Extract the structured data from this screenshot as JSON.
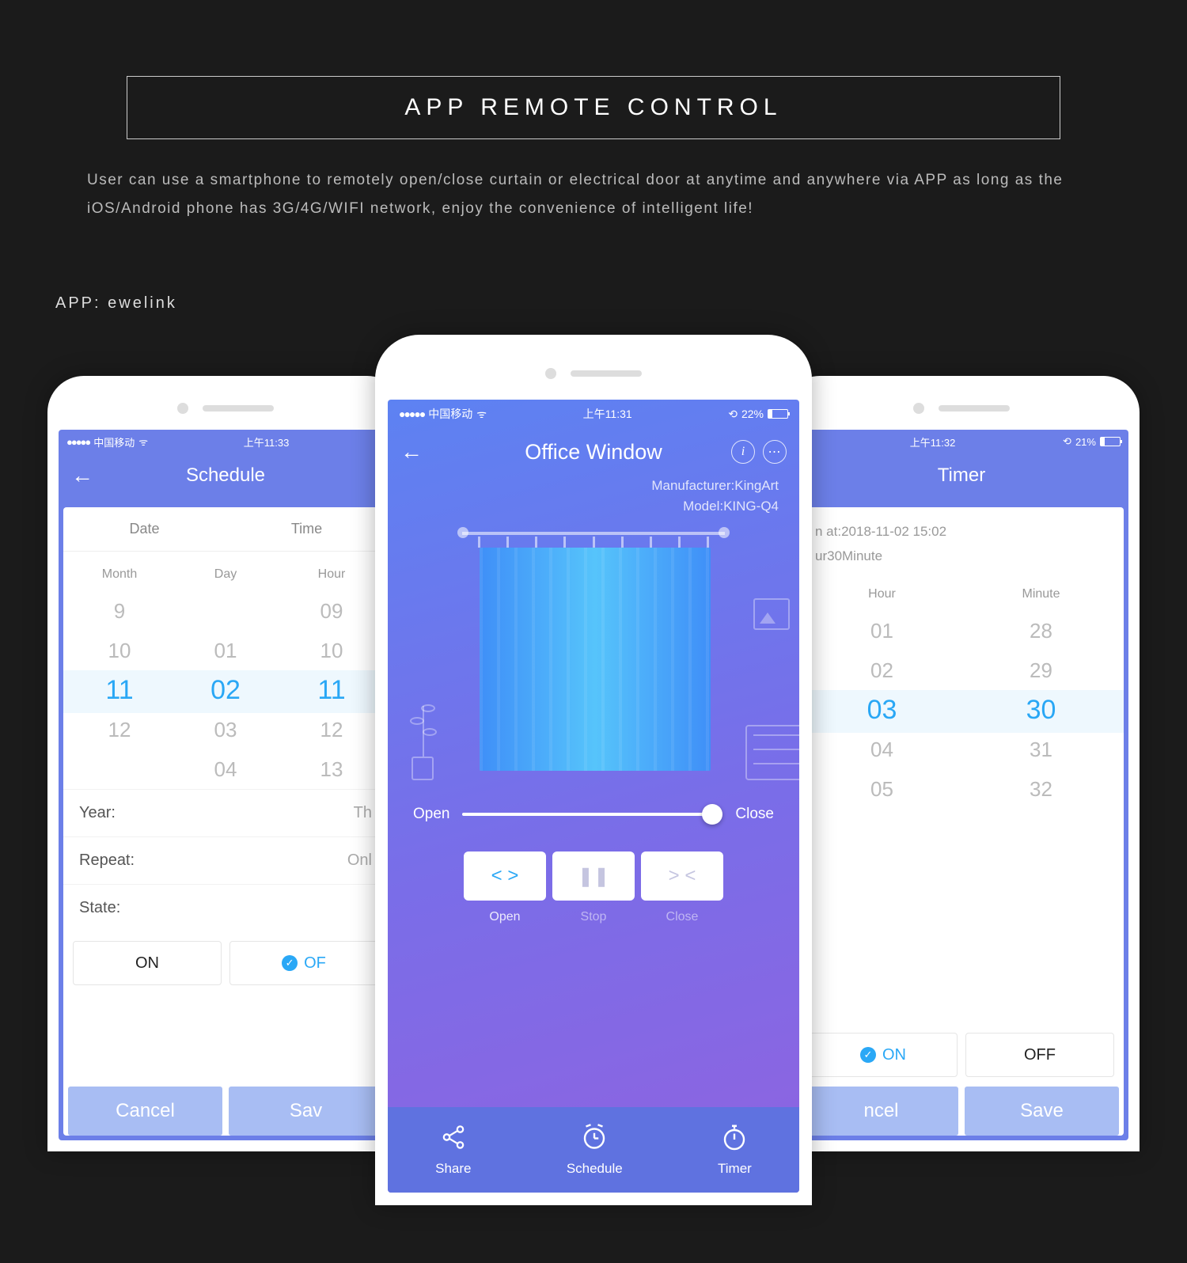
{
  "banner": {
    "title": "APP REMOTE CONTROL",
    "desc": "User can use a smartphone to remotely open/close curtain or electrical door at anytime and anywhere via APP as long as the iOS/Android phone has 3G/4G/WIFI network, enjoy the convenience of intelligent life!"
  },
  "app_label": "APP: ewelink",
  "left": {
    "status": {
      "carrier": "中国移动",
      "time": "上午11:33"
    },
    "title": "Schedule",
    "tabs": [
      "Date",
      "Time"
    ],
    "cols": [
      "Month",
      "Day",
      "Hour"
    ],
    "month": [
      "9",
      "10",
      "11",
      "12",
      ""
    ],
    "day": [
      "",
      "01",
      "02",
      "03",
      "04"
    ],
    "hour": [
      "09",
      "10",
      "11",
      "12",
      "13"
    ],
    "rows": {
      "year": "Year:",
      "year_v": "Th",
      "repeat": "Repeat:",
      "repeat_v": "Onl",
      "state": "State:"
    },
    "on": "ON",
    "off": "OF",
    "cancel": "Cancel",
    "save": "Sav"
  },
  "center": {
    "status": {
      "carrier": "中国移动",
      "time": "上午11:31",
      "batt": "22%"
    },
    "title": "Office Window",
    "manu_l": "Manufacturer:",
    "manu_v": "KingArt",
    "model_l": "Model:",
    "model_v": "KING-Q4",
    "open": "Open",
    "close": "Close",
    "stop": "Stop",
    "nav": {
      "share": "Share",
      "schedule": "Schedule",
      "timer": "Timer"
    }
  },
  "right": {
    "status": {
      "time": "上午11:32",
      "batt": "21%"
    },
    "title": "Timer",
    "info1": "n at:2018-11-02 15:02",
    "info2": "ur30Minute",
    "cols": [
      "Hour",
      "Minute"
    ],
    "hour": [
      "01",
      "02",
      "03",
      "04",
      "05"
    ],
    "minute": [
      "28",
      "29",
      "30",
      "31",
      "32"
    ],
    "on": "ON",
    "off": "OFF",
    "cancel": "ncel",
    "save": "Save"
  }
}
